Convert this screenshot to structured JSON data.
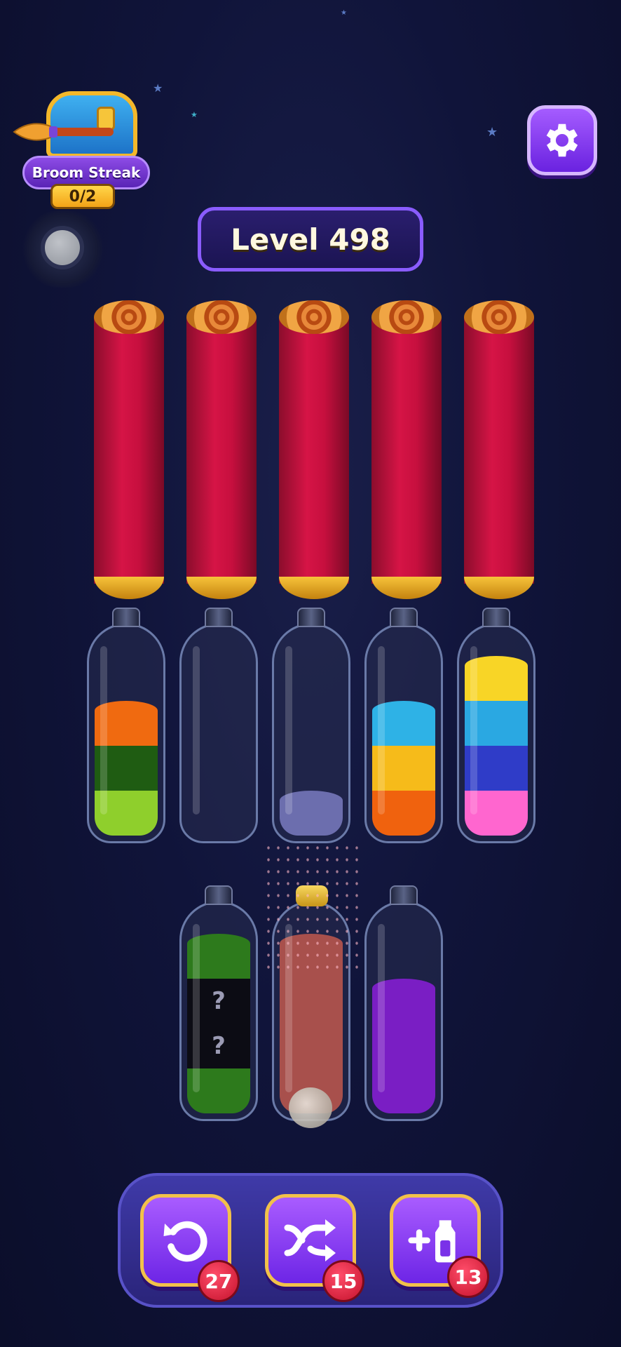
{
  "broom_streak": {
    "label": "Broom Streak",
    "progress": "0/2"
  },
  "level": {
    "title": "Level 498"
  },
  "icons": {
    "settings": "gear-icon",
    "undo": "undo-icon",
    "shuffle": "shuffle-icon",
    "add_bottle": "add-bottle-icon"
  },
  "cylinders_count": 5,
  "bottles_row1": [
    {
      "layers": [
        "#8fcf2c",
        "#1f5c12",
        "#f06a10"
      ],
      "hidden": [
        false,
        false,
        false
      ]
    },
    {
      "layers": [],
      "hidden": []
    },
    {
      "layers": [
        "#6c6eae"
      ],
      "hidden": [
        false
      ]
    },
    {
      "layers": [
        "#f0620e",
        "#f6bb1a",
        "#2eb2e6"
      ],
      "hidden": [
        false,
        false,
        false
      ]
    },
    {
      "layers": [
        "#ff66cf",
        "#2f3cc8",
        "#2aa8e2",
        "#f8d526"
      ],
      "hidden": [
        false,
        false,
        false,
        false
      ]
    }
  ],
  "bottles_row2": [
    {
      "layers": [
        "#2d7a1c",
        "#0c0c14",
        "#0c0c14",
        "#2d7a1c"
      ],
      "hidden": [
        false,
        true,
        true,
        false
      ],
      "hidden_mark": "?"
    },
    {
      "layers": [
        "#a8504c",
        "#a8504c",
        "#a8504c",
        "#a8504c"
      ],
      "hidden": [
        false,
        false,
        false,
        false
      ],
      "corked": true
    },
    {
      "layers": [
        "#7a1ec4",
        "#7a1ec4",
        "#7a1ec4"
      ],
      "hidden": [
        false,
        false,
        false
      ]
    }
  ],
  "tools": [
    {
      "name": "undo",
      "count": "27"
    },
    {
      "name": "shuffle",
      "count": "15"
    },
    {
      "name": "add_bottle",
      "count": "13"
    }
  ]
}
